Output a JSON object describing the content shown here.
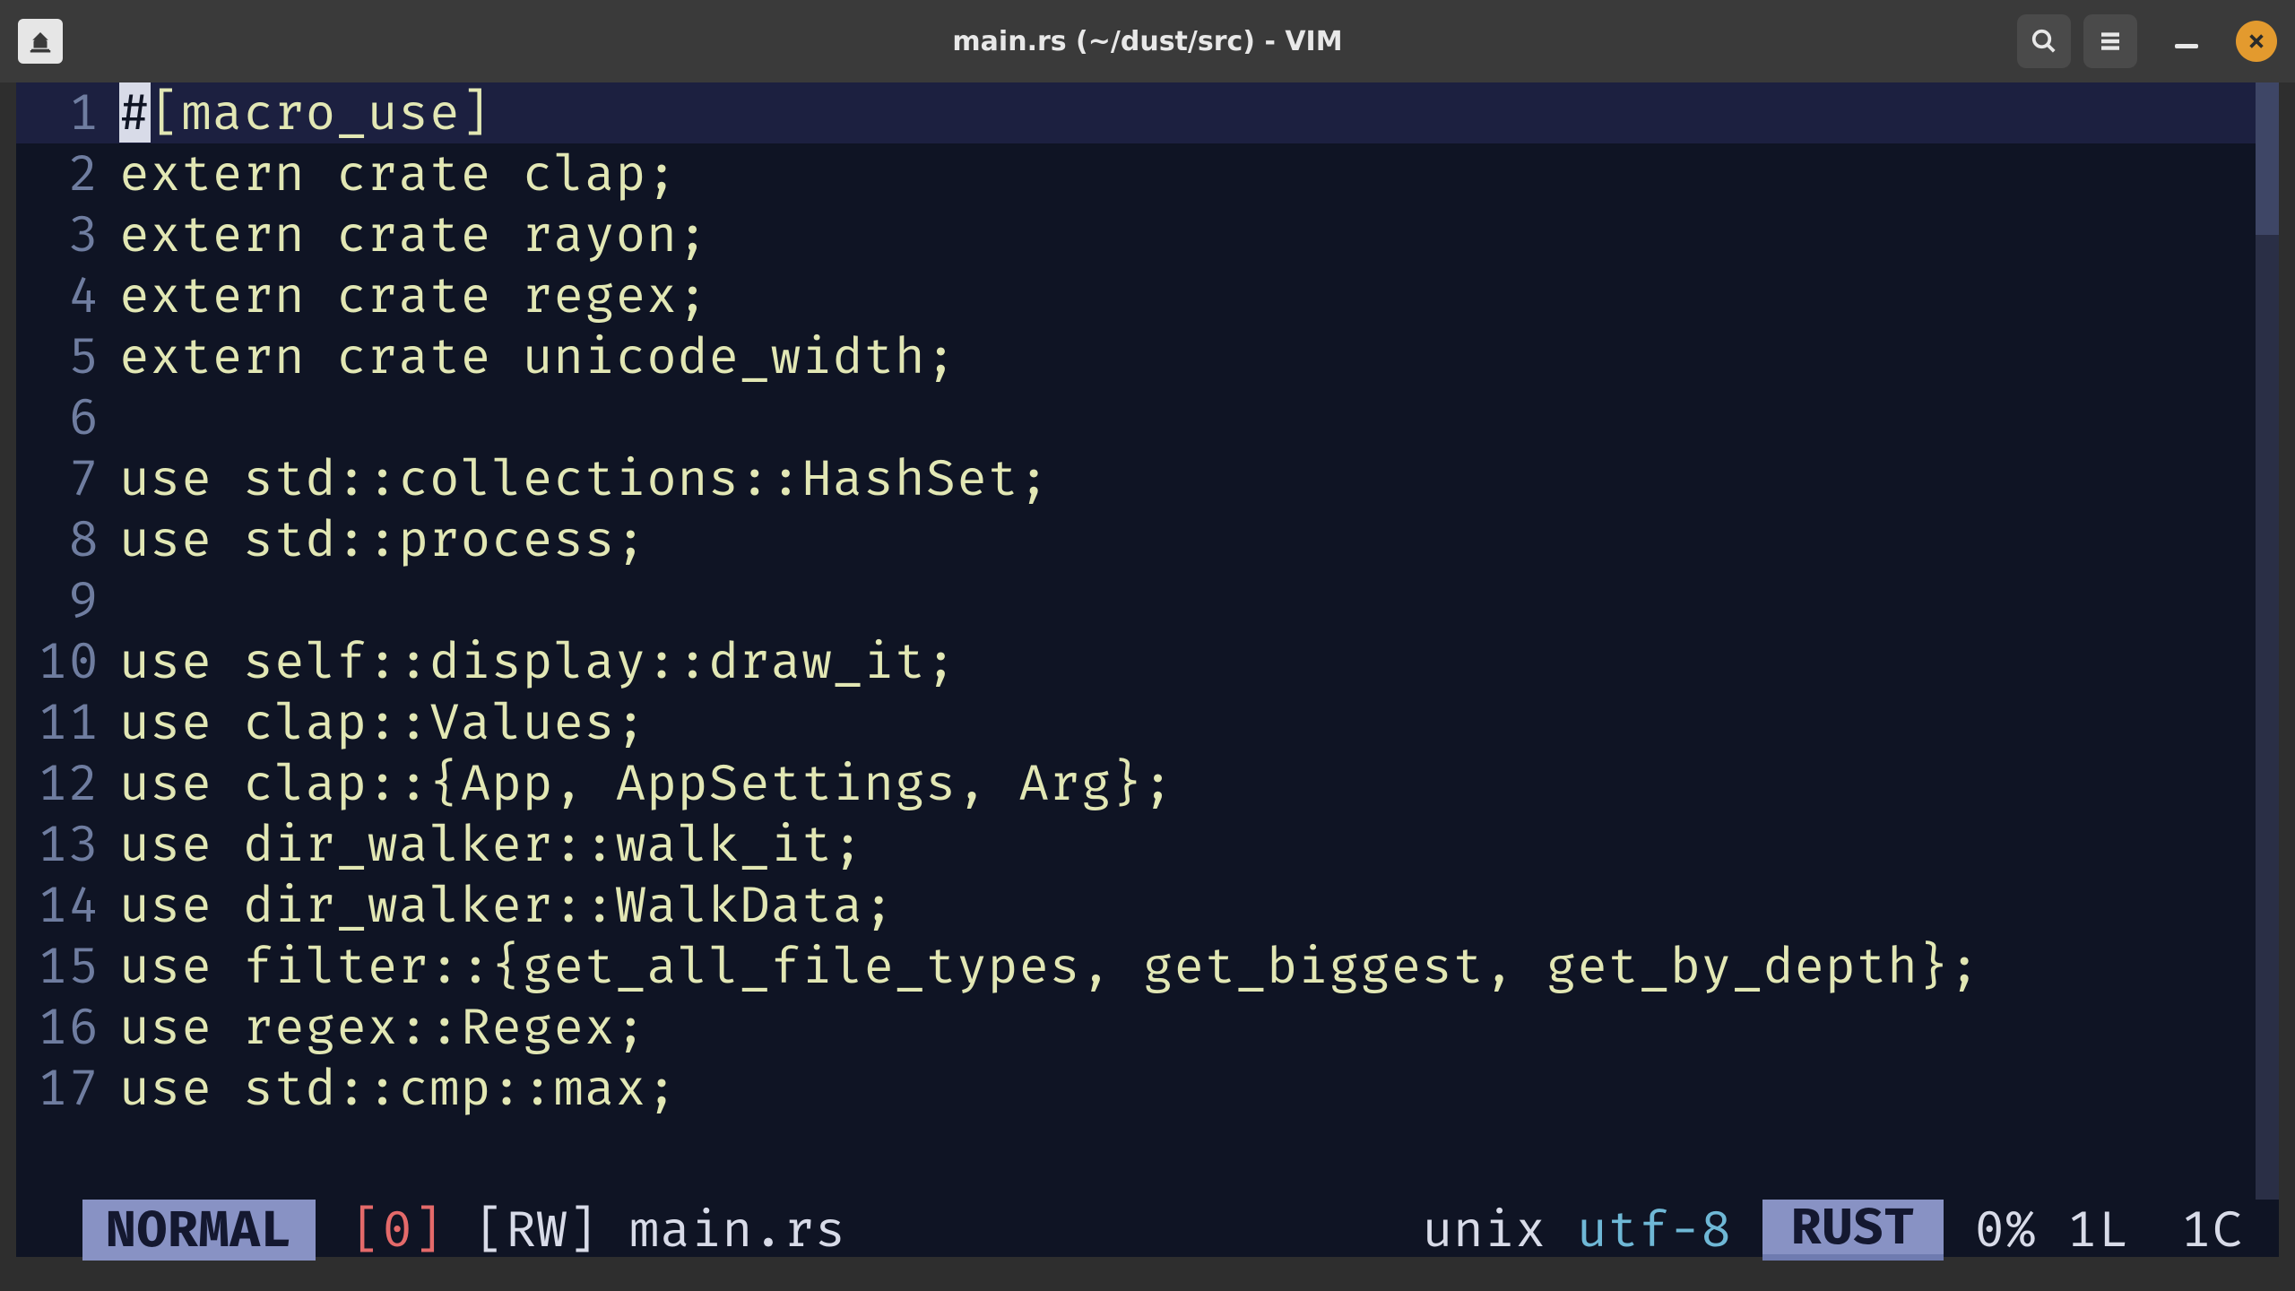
{
  "window": {
    "title": "main.rs (~/dust/src) - VIM"
  },
  "titlebar_icons": {
    "app": "app-icon",
    "search": "search-icon",
    "menu": "hamburger-icon",
    "minimize": "minimize-icon",
    "close": "close-icon"
  },
  "code": {
    "cursor": {
      "line": 1,
      "col": 1,
      "char": "#"
    },
    "lines": [
      {
        "n": "1",
        "pre_cursor": "",
        "post_cursor": "[macro_use]",
        "current": true
      },
      {
        "n": "2",
        "text": "extern crate clap;"
      },
      {
        "n": "3",
        "text": "extern crate rayon;"
      },
      {
        "n": "4",
        "text": "extern crate regex;"
      },
      {
        "n": "5",
        "text": "extern crate unicode_width;"
      },
      {
        "n": "6",
        "text": ""
      },
      {
        "n": "7",
        "text": "use std::collections::HashSet;"
      },
      {
        "n": "8",
        "text": "use std::process;"
      },
      {
        "n": "9",
        "text": ""
      },
      {
        "n": "10",
        "text": "use self::display::draw_it;"
      },
      {
        "n": "11",
        "text": "use clap::Values;"
      },
      {
        "n": "12",
        "text": "use clap::{App, AppSettings, Arg};"
      },
      {
        "n": "13",
        "text": "use dir_walker::walk_it;"
      },
      {
        "n": "14",
        "text": "use dir_walker::WalkData;"
      },
      {
        "n": "15",
        "text": "use filter::{get_all_file_types, get_biggest, get_by_depth};"
      },
      {
        "n": "16",
        "text": "use regex::Regex;"
      },
      {
        "n": "17",
        "text": "use std::cmp::max;"
      }
    ]
  },
  "status": {
    "mode": "NORMAL",
    "buffer": "[0]",
    "rw": "[RW]",
    "filename": "main.rs",
    "fileformat": "unix",
    "encoding": "utf-8",
    "language": "RUST",
    "percent": "0%",
    "line": "1L",
    "col": "1C"
  }
}
